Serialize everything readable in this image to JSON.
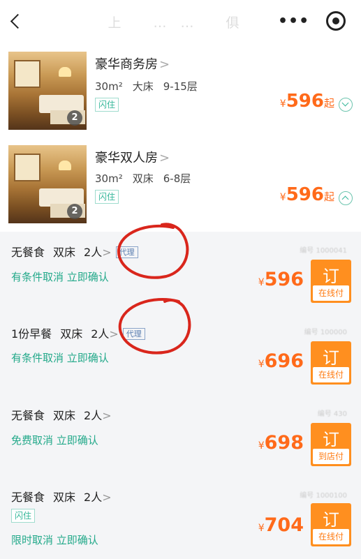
{
  "header": {
    "title": "上 …… 俱",
    "more_label": "•••"
  },
  "rooms": [
    {
      "name": "豪华商务房",
      "area": "30m²",
      "bed": "大床",
      "floor": "9-15层",
      "tag": "闪住",
      "photo_count": "2",
      "price_prefix": "¥",
      "price": "596",
      "price_suffix": "起",
      "expanded": false
    },
    {
      "name": "豪华双人房",
      "area": "30m²",
      "bed": "双床",
      "floor": "6-8层",
      "tag": "闪住",
      "photo_count": "2",
      "price_prefix": "¥",
      "price": "596",
      "price_suffix": "起",
      "expanded": true
    }
  ],
  "plans": [
    {
      "meal": "无餐食",
      "bed": "双床",
      "guests": "2人",
      "agent_tag": "代理",
      "policy": "有条件取消 立即确认",
      "code": "编号 1000041",
      "price_prefix": "¥",
      "price": "596",
      "book_label": "订",
      "pay_label": "在线付"
    },
    {
      "meal": "1份早餐",
      "bed": "双床",
      "guests": "2人",
      "agent_tag": "代理",
      "policy": "有条件取消 立即确认",
      "code": "编号 100000",
      "price_prefix": "¥",
      "price": "696",
      "book_label": "订",
      "pay_label": "在线付"
    },
    {
      "meal": "无餐食",
      "bed": "双床",
      "guests": "2人",
      "policy": "免费取消 立即确认",
      "code": "编号 430",
      "price_prefix": "¥",
      "price": "698",
      "book_label": "订",
      "pay_label": "到店付"
    },
    {
      "meal": "无餐食",
      "bed": "双床",
      "guests": "2人",
      "tag": "闪住",
      "policy": "限时取消 立即确认",
      "code": "编号 1000100",
      "price_prefix": "¥",
      "price": "704",
      "book_label": "订",
      "pay_label": "在线付"
    }
  ],
  "colors": {
    "price": "#ff6a1a",
    "book_button": "#ff8f1f",
    "policy_green": "#23a98a",
    "agent_blue": "#5a7eb0",
    "annotation_red": "#d9261c"
  },
  "icons": [
    "back-arrow-icon",
    "more-dots-icon",
    "target-icon",
    "chevron-down-icon",
    "chevron-up-icon"
  ]
}
